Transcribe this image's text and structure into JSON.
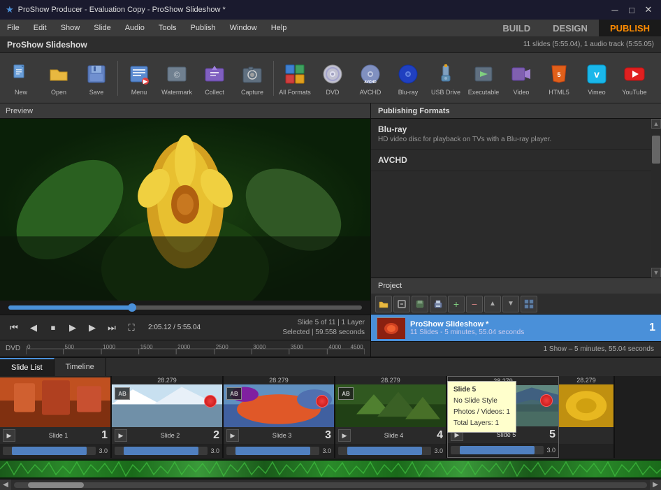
{
  "titlebar": {
    "title": "ProShow Producer - Evaluation Copy - ProShow Slideshow *",
    "app_icon": "★",
    "minimize": "─",
    "maximize": "□",
    "close": "✕"
  },
  "menubar": {
    "items": [
      "File",
      "Edit",
      "Show",
      "Slide",
      "Audio",
      "Tools",
      "Publish",
      "Window",
      "Help"
    ],
    "modes": {
      "build": "BUILD",
      "design": "DESIGN",
      "publish": "PUBLISH"
    }
  },
  "projectbar": {
    "title": "ProShow Slideshow",
    "info": "11 slides (5:55.04), 1 audio track (5:55.05)"
  },
  "toolbar": {
    "buttons": [
      {
        "label": "New",
        "icon": "📄"
      },
      {
        "label": "Open",
        "icon": "📂"
      },
      {
        "label": "Save",
        "icon": "💾"
      },
      {
        "label": "Menu",
        "icon": "📋"
      },
      {
        "label": "Watermark",
        "icon": "🔷"
      },
      {
        "label": "Collect",
        "icon": "📦"
      },
      {
        "label": "Capture",
        "icon": "📷"
      },
      {
        "label": "All Formats",
        "icon": "▦"
      },
      {
        "label": "DVD",
        "icon": "💿"
      },
      {
        "label": "AVCHD",
        "icon": "📀"
      },
      {
        "label": "Blu-ray",
        "icon": "🔵"
      },
      {
        "label": "USB Drive",
        "icon": "🔌"
      },
      {
        "label": "Executable",
        "icon": "⚙"
      },
      {
        "label": "Video",
        "icon": "🎬"
      },
      {
        "label": "HTML5",
        "icon": "🌐"
      },
      {
        "label": "Vimeo",
        "icon": "▶"
      },
      {
        "label": "YouTube",
        "icon": "▶"
      }
    ]
  },
  "preview": {
    "header": "Preview",
    "time_current": "2:05.12",
    "time_total": "5:55.04",
    "slide_info_line1": "Slide 5 of 11  |  1 Layer",
    "slide_info_line2": "Selected  |  59.558 seconds"
  },
  "timeline": {
    "label": "DVD",
    "ticks": [
      "0",
      "500",
      "1000",
      "1500",
      "2000",
      "2500",
      "3000",
      "3500",
      "4000",
      "4500"
    ]
  },
  "publishing": {
    "header": "Publishing Formats",
    "formats": [
      {
        "name": "Blu-ray",
        "desc": "HD video disc for playback on TVs with a Blu-ray player."
      },
      {
        "name": "AVCHD",
        "desc": ""
      }
    ],
    "project_label": "Project",
    "status": "1 Show – 5 minutes, 55.04 seconds",
    "project_entry": {
      "name": "ProShow Slideshow *",
      "details": "11 Slides - 5 minutes, 55.04 seconds",
      "number": "1"
    }
  },
  "filmstrip": {
    "tabs": [
      "Slide List",
      "Timeline"
    ],
    "active_tab": "Slide List",
    "slides": [
      {
        "name": "Slide 1",
        "num": "1",
        "duration": "3.0",
        "thumb_class": "thumb-red-canyon",
        "has_ab": false,
        "has_red_dot": false
      },
      {
        "name": "Slide 2",
        "num": "2",
        "duration": "3.0",
        "thumb_class": "thumb-glacier",
        "has_ab": true,
        "has_red_dot": true
      },
      {
        "name": "Slide 3",
        "num": "3",
        "duration": "3.0",
        "thumb_class": "thumb-tropical",
        "has_ab": true,
        "has_red_dot": true
      },
      {
        "name": "Slide 4",
        "num": "4",
        "duration": "3.0",
        "thumb_class": "thumb-forest",
        "has_ab": true,
        "has_red_dot": false
      },
      {
        "name": "Slide 5",
        "num": "5",
        "duration": "3.0",
        "thumb_class": "thumb-waterfall",
        "has_ab": true,
        "has_red_dot": true
      },
      {
        "name": "",
        "num": "",
        "duration": "",
        "thumb_class": "thumb-yellow",
        "has_ab": false,
        "has_red_dot": false
      }
    ],
    "slide_durations_above": [
      "28.279",
      "28.279",
      "28.279",
      "28.279",
      "28.279"
    ],
    "tooltip": {
      "title": "Slide 5",
      "line1": "No Slide Style",
      "line2": "Photos / Videos: 1",
      "line3": "Total Layers: 1"
    }
  }
}
